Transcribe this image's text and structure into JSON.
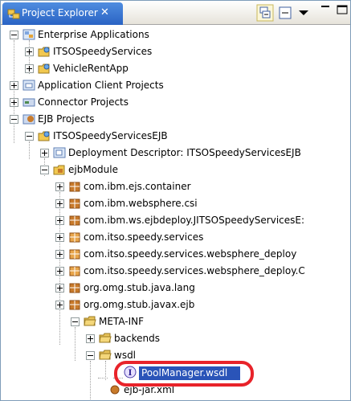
{
  "window": {
    "tab_title": "Project Explorer",
    "close_glyph": "✕",
    "toolbar": {
      "collapse_all": "collapse-all-icon",
      "link_editor": "link-with-editor-icon",
      "view_menu": "view-menu-icon",
      "minimize": "minimize-icon",
      "maximize": "maximize-icon"
    }
  },
  "tree": [
    {
      "label": "Enterprise Applications",
      "icon": "enterprise-app-icon",
      "expander": "minus"
    },
    {
      "label": "ITSOSpeedyServices",
      "icon": "ear-project-icon",
      "expander": "plus"
    },
    {
      "label": "VehicleRentApp",
      "icon": "ear-project-icon",
      "expander": "plus"
    },
    {
      "label": "Application Client Projects",
      "icon": "appclient-icon",
      "expander": "plus"
    },
    {
      "label": "Connector Projects",
      "icon": "connector-icon",
      "expander": "plus"
    },
    {
      "label": "EJB Projects",
      "icon": "ejb-projects-icon",
      "expander": "minus"
    },
    {
      "label": "ITSOSpeedyServicesEJB",
      "icon": "ejb-project-icon",
      "expander": "minus"
    },
    {
      "label": "Deployment Descriptor: ITSOSpeedyServicesEJB",
      "icon": "deployment-descriptor-icon",
      "expander": "plus"
    },
    {
      "label": "ejbModule",
      "icon": "source-folder-icon",
      "expander": "minus"
    },
    {
      "label": "com.ibm.ejs.container",
      "icon": "package-icon",
      "expander": "plus"
    },
    {
      "label": "com.ibm.websphere.csi",
      "icon": "package-icon",
      "expander": "plus"
    },
    {
      "label": "com.ibm.ws.ejbdeploy.JITSOSpeedyServicesE:",
      "icon": "package-icon",
      "expander": "plus"
    },
    {
      "label": "com.itso.speedy.services",
      "icon": "package-icon",
      "expander": "plus"
    },
    {
      "label": "com.itso.speedy.services.websphere_deploy",
      "icon": "package-icon",
      "expander": "plus"
    },
    {
      "label": "com.itso.speedy.services.websphere_deploy.C",
      "icon": "package-icon",
      "expander": "plus"
    },
    {
      "label": "org.omg.stub.java.lang",
      "icon": "package-icon",
      "expander": "plus"
    },
    {
      "label": "org.omg.stub.javax.ejb",
      "icon": "package-icon",
      "expander": "plus"
    },
    {
      "label": "META-INF",
      "icon": "folder-icon",
      "expander": "minus"
    },
    {
      "label": "backends",
      "icon": "folder-icon",
      "expander": "plus"
    },
    {
      "label": "wsdl",
      "icon": "folder-icon",
      "expander": "minus"
    },
    {
      "label": "PoolManager.wsdl",
      "icon": "wsdl-file-icon",
      "expander": "none",
      "selected": true
    },
    {
      "label": "ejb-jar.xml",
      "icon": "xml-file-icon",
      "expander": "none"
    }
  ],
  "colors": {
    "tab_active": "#2a63c4",
    "selection": "#2a54b8",
    "highlight_ring": "#e8232a",
    "package": "#c87a2a",
    "folder": "#e8c35a"
  }
}
